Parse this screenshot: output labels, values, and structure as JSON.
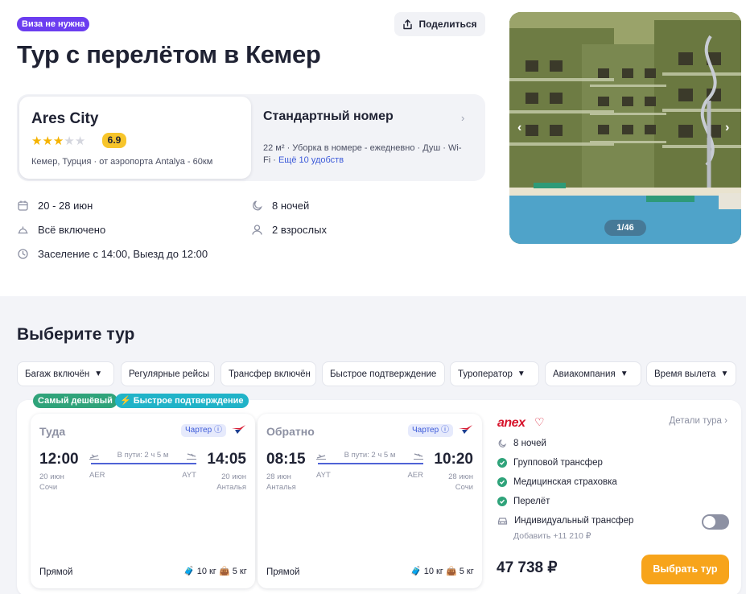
{
  "header": {
    "visa_badge": "Виза не нужна",
    "share_label": "Поделиться",
    "title": "Тур с перелётом в Кемер"
  },
  "hotel": {
    "name": "Ares City",
    "stars": 3,
    "stars_max": 5,
    "rating": "6.9",
    "location": "Кемер, Турция · от аэропорта Antalya - 60км"
  },
  "room": {
    "title": "Стандартный номер",
    "amenities": "22 м² · Уборка в номере - ежедневно · Душ · Wi-Fi ·",
    "more_link": "Ещё 10 удобств"
  },
  "facts": {
    "dates": "20 - 28 июн",
    "nights": "8 ночей",
    "meals": "Всё включено",
    "guests": "2 взрослых",
    "checkin": "Заселение с 14:00, Выезд до 12:00"
  },
  "gallery": {
    "counter": "1/46"
  },
  "tours": {
    "section_title": "Выберите тур",
    "filters": [
      "Багаж включён",
      "Регулярные рейсы",
      "Трансфер включён",
      "Быстрое подтверждение",
      "Туроператор",
      "Авиакомпания",
      "Время вылета"
    ],
    "tags": {
      "cheapest": "Самый дешёвый",
      "fast_confirm": "Быстрое подтверждение"
    },
    "offer": {
      "outbound": {
        "title": "Туда",
        "charter": "Чартер",
        "dep_time": "12:00",
        "dep_date": "20 июн",
        "dep_city": "Сочи",
        "duration": "В пути: 2 ч 5 м",
        "dep_code": "AER",
        "arr_code": "AYT",
        "arr_time": "14:05",
        "arr_date": "20 июн",
        "arr_city": "Анталья",
        "type": "Прямой",
        "bag_main": "10 кг",
        "bag_hand": "5 кг"
      },
      "inbound": {
        "title": "Обратно",
        "charter": "Чартер",
        "dep_time": "08:15",
        "dep_date": "28 июн",
        "dep_city": "Анталья",
        "duration": "В пути: 2 ч 5 м",
        "dep_code": "AYT",
        "arr_code": "AER",
        "arr_time": "10:20",
        "arr_date": "28 июн",
        "arr_city": "Сочи",
        "type": "Прямой",
        "bag_main": "10 кг",
        "bag_hand": "5 кг"
      },
      "operator": "anex",
      "details_link": "Детали тура",
      "nights": "8 ночей",
      "included": [
        "Групповой трансфер",
        "Медицинская страховка",
        "Перелёт"
      ],
      "individual_transfer": "Индивидуальный трансфер",
      "individual_transfer_add": "Добавить +11 210 ₽",
      "price": "47 738 ₽",
      "choose_label": "Выбрать тур"
    }
  },
  "colors": {
    "accent_orange": "#f7a41b",
    "visa_purple": "#6b3df0",
    "cheapest_green": "#2fa37a",
    "fast_teal": "#20b3c8",
    "rating_yellow": "#f7c52b",
    "anex_red": "#d7142c"
  }
}
